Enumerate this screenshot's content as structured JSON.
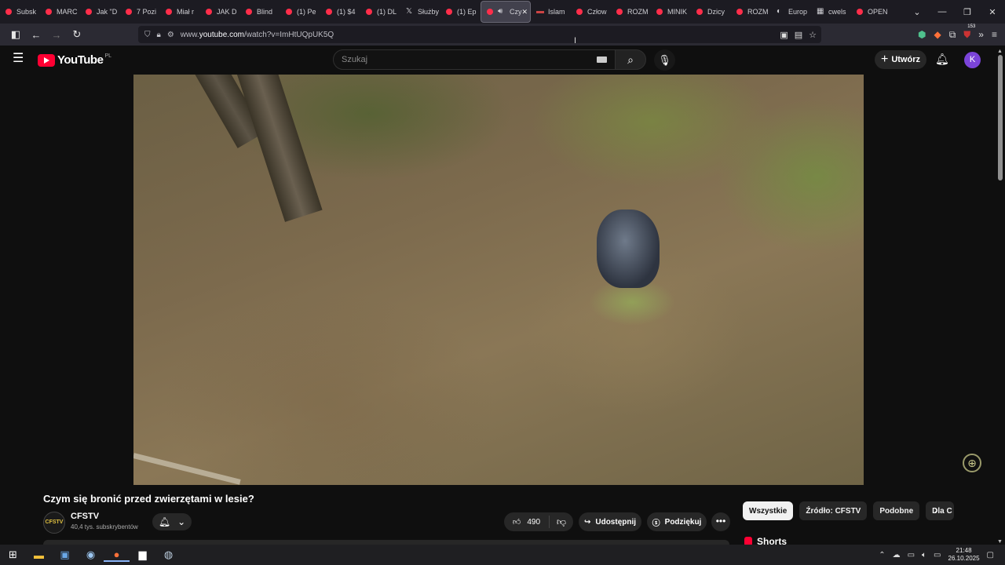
{
  "browser": {
    "tabs": [
      {
        "label": "Subsk",
        "type": "yt"
      },
      {
        "label": "MARC",
        "type": "yt"
      },
      {
        "label": "Jak \"D",
        "type": "yt"
      },
      {
        "label": "7 Pozi",
        "type": "yt"
      },
      {
        "label": "Miał r",
        "type": "yt"
      },
      {
        "label": "JAK D",
        "type": "yt"
      },
      {
        "label": "Blind",
        "type": "yt"
      },
      {
        "label": "(1) Pe",
        "type": "yt"
      },
      {
        "label": "(1) $4",
        "type": "yt"
      },
      {
        "label": "(1) DL",
        "type": "yt"
      },
      {
        "label": "Służby",
        "type": "x"
      },
      {
        "label": "(1) Ep",
        "type": "yt"
      },
      {
        "label": "Czy",
        "type": "active"
      },
      {
        "label": "Islam",
        "type": "flag"
      },
      {
        "label": "Człow",
        "type": "yt"
      },
      {
        "label": "ROZM",
        "type": "yt"
      },
      {
        "label": "MINIK",
        "type": "yt"
      },
      {
        "label": "Dzicy",
        "type": "yt"
      },
      {
        "label": "ROZM",
        "type": "yt"
      },
      {
        "label": "Europ",
        "type": "globe"
      },
      {
        "label": "cwels",
        "type": "grid"
      },
      {
        "label": "OPEN",
        "type": "yt"
      }
    ],
    "url_prefix": "www.",
    "url_domain": "youtube.com",
    "url_path": "/watch?v=ImHtUQpUK5Q",
    "ext_badge": "153"
  },
  "yt": {
    "logo_text": "YouTube",
    "country": "PL",
    "search_placeholder": "Szukaj",
    "create_label": "Utwórz",
    "avatar_letter": "K",
    "video_title": "Czym się bronić przed zwierzętami w lesie?",
    "channel_logo_text": "CFSTV",
    "channel_name": "CFSTV",
    "subscribers": "40,4 tys. subskrybentów",
    "likes": "490",
    "share_label": "Udostępnij",
    "thanks_label": "Podziękuj",
    "chips": [
      "Wszystkie",
      "Źródło: CFSTV",
      "Podobne",
      "Dla C"
    ],
    "shorts_label": "Shorts"
  },
  "taskbar": {
    "time": "21:48",
    "date": "26.10.2025"
  }
}
